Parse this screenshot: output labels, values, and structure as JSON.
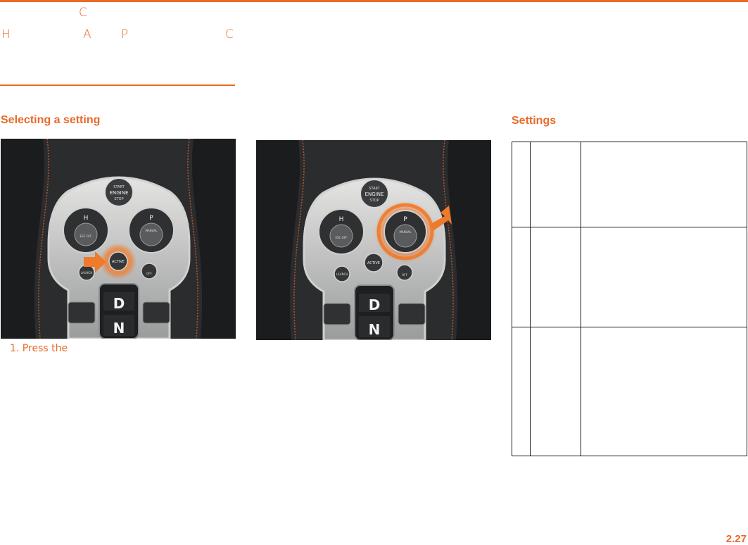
{
  "header": {
    "glyphs": [
      {
        "id": "h0",
        "text": "C"
      },
      {
        "id": "h1",
        "text": "H"
      },
      {
        "id": "h2",
        "text": "A"
      },
      {
        "id": "h3",
        "text": "P"
      },
      {
        "id": "h4",
        "text": "C"
      }
    ]
  },
  "left_section": {
    "title": "Selecting a setting",
    "caption": "1.  Press the"
  },
  "right_section": {
    "title": "Settings",
    "table_rows": 3
  },
  "console": {
    "start_top": "START",
    "start_main": "ENGINE",
    "start_bottom": "STOP",
    "left_dial_letter": "H",
    "left_dial_label": "ESC OFF",
    "right_dial_letter": "P",
    "right_dial_label": "MANUAL",
    "active_label": "ACTIVE",
    "launch_label": "LAUNCH",
    "auto_label": "OFF",
    "gear_d": "D",
    "gear_n": "N"
  },
  "colors": {
    "accent": "#ea6b24",
    "highlight": "#f07a2a"
  },
  "footer": {
    "page_number": "2.27"
  }
}
